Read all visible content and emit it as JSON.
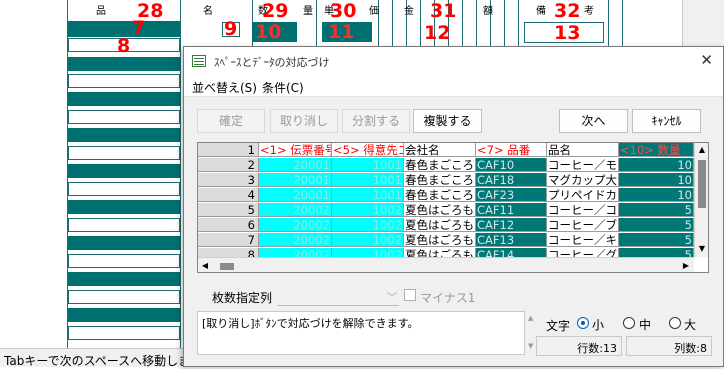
{
  "form": {
    "labels": [
      "品",
      "名",
      "数",
      "量",
      "単",
      "価",
      "金",
      "額",
      "備",
      "考"
    ],
    "numbers": [
      "28",
      "29",
      "30",
      "31",
      "32",
      "7",
      "9",
      "10",
      "11",
      "12",
      "13",
      "8"
    ]
  },
  "status_bar": "Tabキーで次のスペースへ移動します",
  "dialog": {
    "title": "ｽﾍﾟｰｽとﾃﾞｰﾀの対応づけ",
    "menu": [
      "並べ替え(S)",
      "条件(C)"
    ],
    "buttons": {
      "confirm": "確定",
      "undo": "取り消し",
      "split": "分割する",
      "duplicate": "複製する",
      "next": "次へ",
      "cancel": "ｷｬﾝｾﾙ"
    },
    "grid": {
      "header_row_number": "1",
      "columns": [
        "<1> 伝票番号",
        "<5> 得意先コ",
        "会社名",
        "<7> 品番",
        "品名",
        "<10> 数量"
      ],
      "rows": [
        {
          "n": "2",
          "c": [
            "20001",
            "1001",
            "春色まごころ",
            "CAF10",
            "コーヒー／モ",
            "10"
          ]
        },
        {
          "n": "3",
          "c": [
            "20001",
            "1001",
            "春色まごころ",
            "CAF18",
            "マグカップ大",
            "10"
          ]
        },
        {
          "n": "4",
          "c": [
            "20001",
            "1001",
            "春色まごころ",
            "CAF23",
            "プリペイドカ",
            "10"
          ]
        },
        {
          "n": "5",
          "c": [
            "20002",
            "1002",
            "夏色はごろも",
            "CAF11",
            "コーヒー／コ",
            "5"
          ]
        },
        {
          "n": "6",
          "c": [
            "20002",
            "1002",
            "夏色はごろも",
            "CAF12",
            "コーヒー／ブ",
            "5"
          ]
        },
        {
          "n": "7",
          "c": [
            "20002",
            "1002",
            "夏色はごろも",
            "CAF13",
            "コーヒー／キ",
            "5"
          ]
        },
        {
          "n": "8",
          "c": [
            "20002",
            "1002",
            "夏色はごろも",
            "CAF14",
            "コーヒー／グ",
            "5"
          ]
        }
      ]
    },
    "sheet_count_label": "枚数指定列",
    "sheet_count_value": "",
    "minus_label": "マイナス1",
    "message": "[取り消し]ﾎﾞﾀﾝで対応づけを解除できます。",
    "text_size": {
      "label": "文字",
      "options": [
        "小",
        "中",
        "大"
      ],
      "selected": "小"
    },
    "row_count": "行数:13",
    "col_count": "列数:8"
  }
}
